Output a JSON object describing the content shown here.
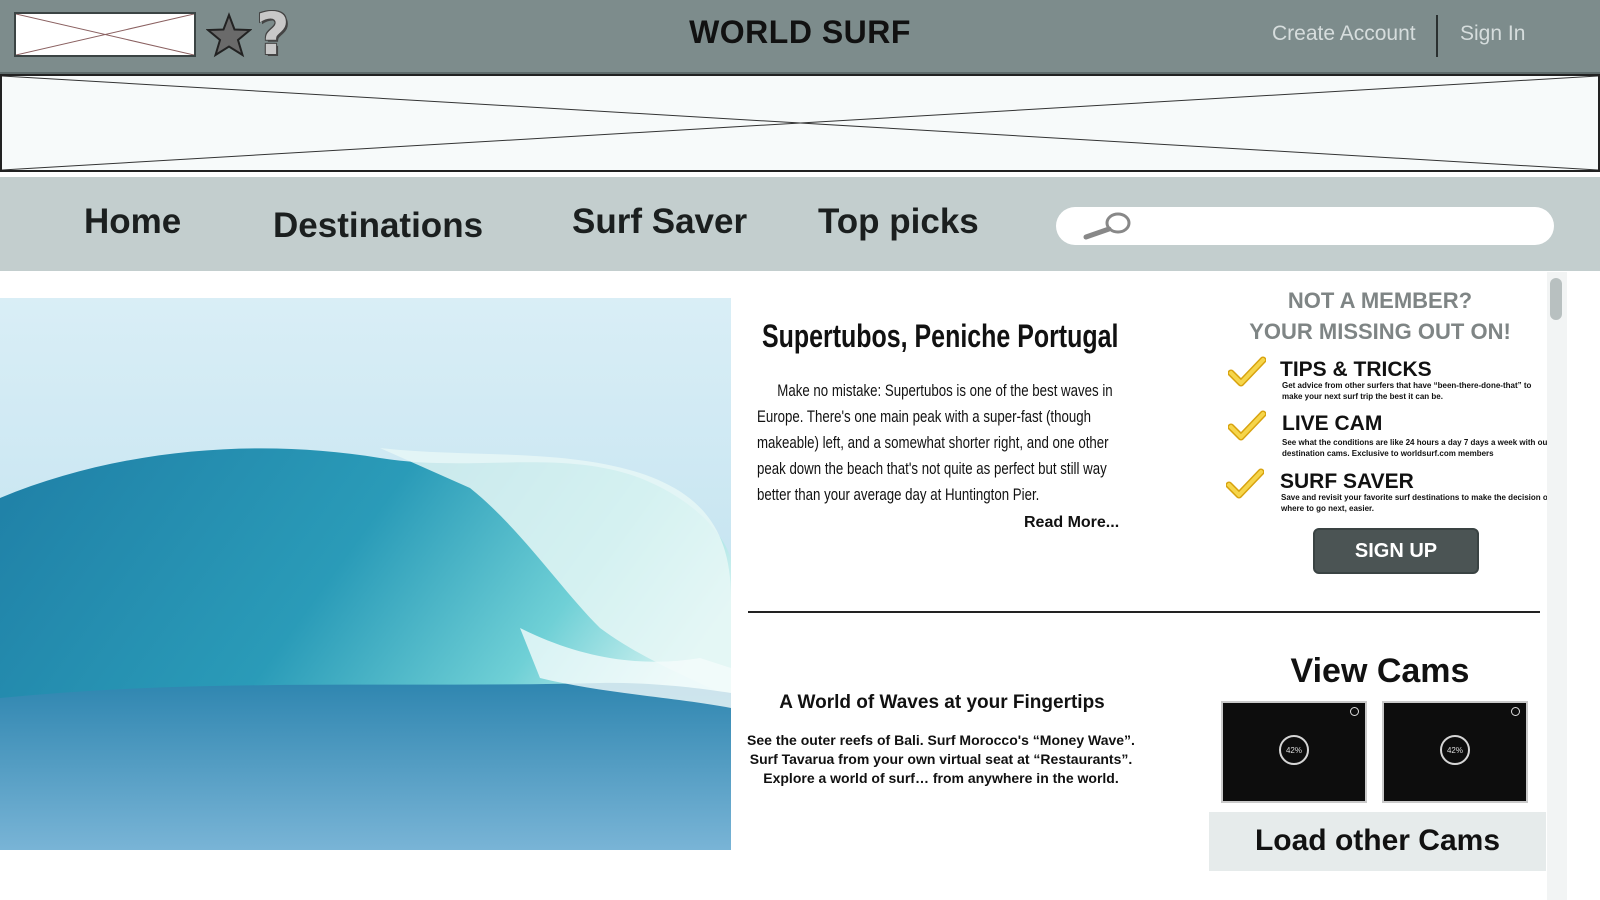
{
  "header": {
    "title": "WORLD SURF",
    "create_account": "Create Account",
    "sign_in": "Sign In",
    "help_symbol": "?"
  },
  "nav": {
    "items": [
      "Home",
      "Destinations",
      "Surf Saver",
      "Top picks"
    ],
    "search_placeholder": ""
  },
  "article": {
    "title": "Supertubos, Peniche Portugal",
    "body": "Make no mistake: Supertubos is one of the best waves in Europe. There's one main peak with a super-fast (though makeable) left, and a somewhat shorter right, and one other peak down the beach that's not quite as perfect but still way better than your average day at Huntington Pier.",
    "read_more": "Read More..."
  },
  "membership": {
    "heading_line1": "NOT A MEMBER?",
    "heading_line2": "YOUR MISSING OUT ON!",
    "benefits": [
      {
        "title": "TIPS & TRICKS",
        "desc": "Get advice from other surfers that have “been-there-done-that” to make your next surf trip the best it can be."
      },
      {
        "title": "LIVE CAM",
        "desc": "See what the conditions are like 24 hours a day 7 days a week with our destination cams. Exclusive to worldsurf.com members"
      },
      {
        "title": "SURF SAVER",
        "desc": "Save and revisit your favorite surf destinations to make the decision of where to go next, easier."
      }
    ],
    "signup_label": "SIGN UP",
    "check_color": "#f2c418"
  },
  "promo": {
    "title": "A World of Waves at your Fingertips",
    "body": "See the outer reefs of Bali. Surf Morocco's “Money Wave”. Surf Tavarua from your own virtual seat at “Restaurants”. Explore a world of surf… from anywhere in the world."
  },
  "cams": {
    "title": "View Cams",
    "loading": [
      "42%",
      "42%"
    ],
    "load_other_label": "Load other Cams"
  },
  "colors": {
    "header_bg": "#7d8c8c",
    "nav_bg": "#c3cece",
    "button_dark": "#4b5454"
  }
}
